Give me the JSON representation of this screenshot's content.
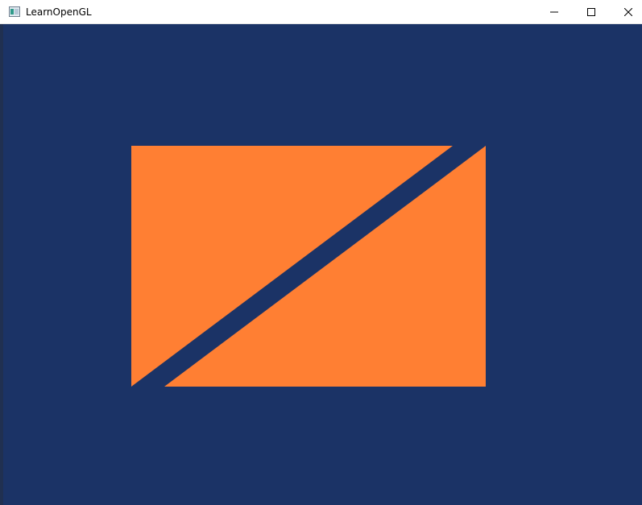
{
  "window": {
    "title": "LearnOpenGL"
  },
  "title_controls": {
    "minimize_icon": "minimize-icon",
    "maximize_icon": "maximize-icon",
    "close_icon": "close-icon"
  },
  "scene": {
    "clear_color": "#1b3366",
    "shape_color": "#ff7f33"
  }
}
